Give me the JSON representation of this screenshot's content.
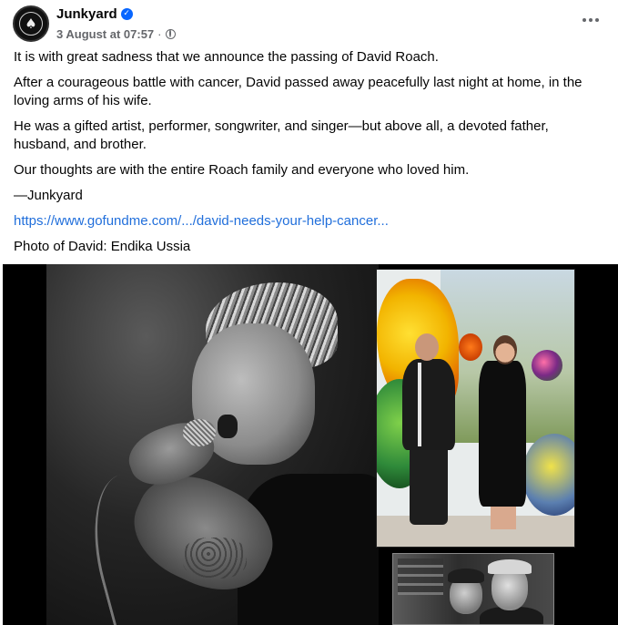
{
  "post": {
    "author": "Junkyard",
    "verified": true,
    "timestamp": "3 August at 07:57",
    "separator": "·",
    "audience_icon": "globe-icon",
    "more_icon": "more-options-icon"
  },
  "body": {
    "paragraphs": [
      "It is with great sadness that we announce the passing of David Roach.",
      "After a courageous battle with cancer, David passed away peacefully last night at home, in the loving arms of his wife.",
      "He was a gifted artist, performer, songwriter, and singer—but above all, a devoted father, husband, and brother.",
      "Our thoughts are with the entire Roach family and everyone who loved him.",
      "—Junkyard"
    ],
    "link": "https://www.gofundme.com/.../david-needs-your-help-cancer...",
    "photo_credit": "Photo of David: Endika Ussia"
  },
  "colors": {
    "link": "#216fdb",
    "verified_badge": "#0866ff",
    "secondary_text": "#65676b"
  }
}
